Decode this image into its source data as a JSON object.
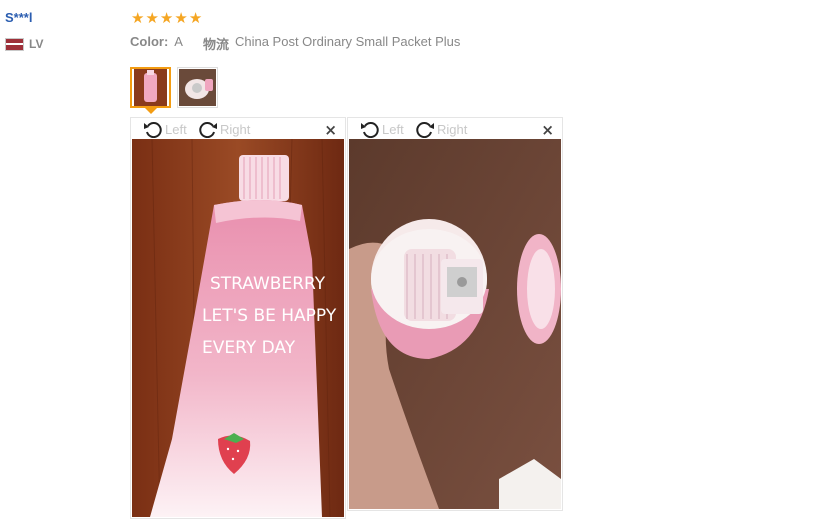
{
  "reviewer": {
    "name": "S***l",
    "country": "LV"
  },
  "rating": {
    "value": 5,
    "max": 5
  },
  "meta": {
    "color_label": "Color:",
    "color_value": "A",
    "shipping_label": "物流",
    "shipping_value": "China Post Ordinary Small Packet Plus"
  },
  "viewer": {
    "rotate_left": "Left",
    "rotate_right": "Right",
    "close": "×"
  },
  "photo_text": {
    "line1": "STRAWBERRY",
    "line2": "LET'S BE HAPPY",
    "line3": "EVERY DAY"
  },
  "colors": {
    "star": "#f5a623",
    "active_thumb": "#f39c12",
    "username": "#2a5db0"
  }
}
